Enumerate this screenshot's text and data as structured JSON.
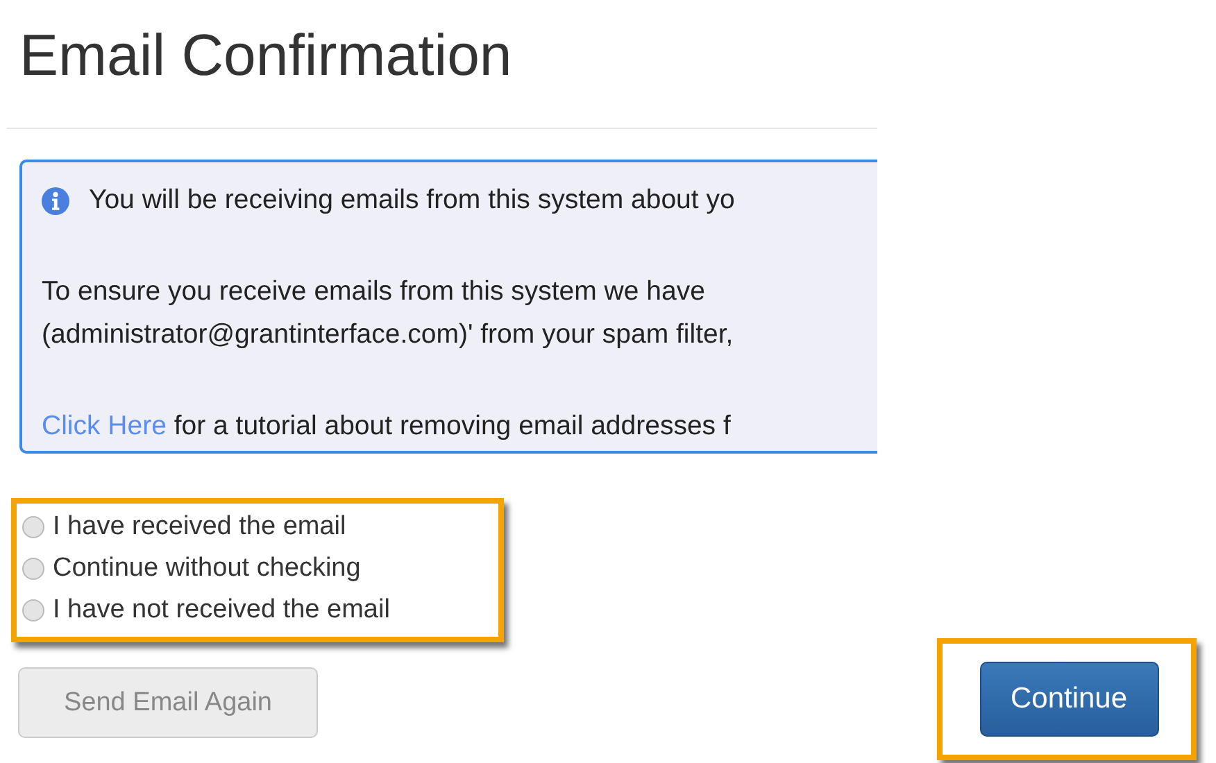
{
  "title": "Email Confirmation",
  "info": {
    "lines": [
      {
        "kind": "icon",
        "text": "You will be receiving emails from this system about yo"
      },
      {
        "kind": "gap"
      },
      {
        "kind": "plain",
        "text": "To ensure you receive emails from this system we have"
      },
      {
        "kind": "plain",
        "text": "(administrator@grantinterface.com)' from your spam filter,"
      },
      {
        "kind": "gap"
      },
      {
        "kind": "link",
        "link": "Click Here",
        "text": " for a tutorial about removing email addresses f"
      }
    ]
  },
  "options": [
    {
      "label": "I have received the email",
      "selected": false
    },
    {
      "label": "Continue without checking",
      "selected": false
    },
    {
      "label": "I have not received the email",
      "selected": false
    }
  ],
  "send_button": {
    "label": "Send Email Again",
    "disabled": true
  },
  "continue_button": {
    "label": "Continue",
    "disabled": false
  }
}
